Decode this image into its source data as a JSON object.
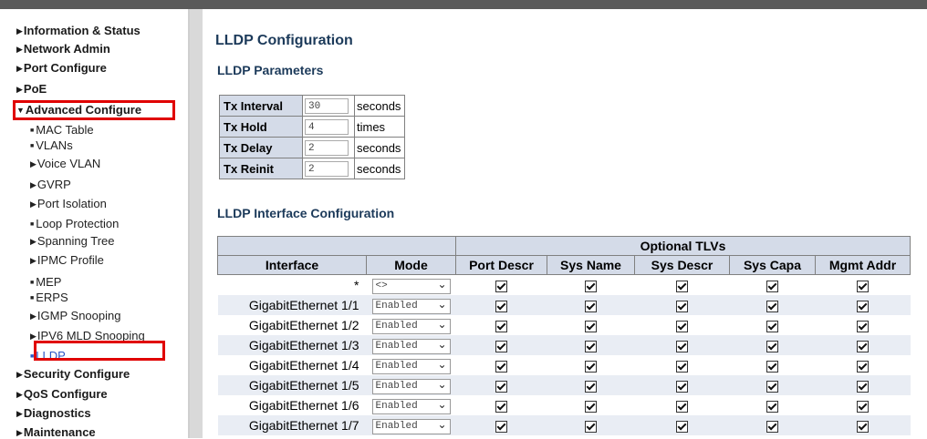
{
  "sidebar": {
    "items": [
      {
        "label": "Information & Status"
      },
      {
        "label": "Network Admin"
      },
      {
        "label": "Port Configure"
      },
      {
        "label": "PoE"
      },
      {
        "label": "Advanced Configure"
      },
      {
        "label": "Security Configure"
      },
      {
        "label": "QoS Configure"
      },
      {
        "label": "Diagnostics"
      },
      {
        "label": "Maintenance"
      }
    ],
    "sub_items": [
      {
        "label": "MAC Table"
      },
      {
        "label": "VLANs"
      },
      {
        "label": "Voice VLAN"
      },
      {
        "label": "GVRP"
      },
      {
        "label": "Port Isolation"
      },
      {
        "label": "Loop Protection"
      },
      {
        "label": "Spanning Tree"
      },
      {
        "label": "IPMC Profile"
      },
      {
        "label": "MEP"
      },
      {
        "label": "ERPS"
      },
      {
        "label": "IGMP Snooping"
      },
      {
        "label": "IPV6 MLD Snooping"
      },
      {
        "label": "LLDP"
      }
    ]
  },
  "page": {
    "title": "LLDP Configuration",
    "params_heading": "LLDP Parameters",
    "intf_heading": "LLDP Interface Configuration"
  },
  "params": [
    {
      "label": "Tx Interval",
      "value": "30",
      "unit": "seconds"
    },
    {
      "label": "Tx Hold",
      "value": "4",
      "unit": "times"
    },
    {
      "label": "Tx Delay",
      "value": "2",
      "unit": "seconds"
    },
    {
      "label": "Tx Reinit",
      "value": "2",
      "unit": "seconds"
    }
  ],
  "intf_table": {
    "group_header": "Optional TLVs",
    "headers": [
      "Interface",
      "Mode",
      "Port Descr",
      "Sys Name",
      "Sys Descr",
      "Sys Capa",
      "Mgmt Addr"
    ],
    "rows": [
      {
        "interface": "*",
        "mode": "<>"
      },
      {
        "interface": "GigabitEthernet 1/1",
        "mode": "Enabled"
      },
      {
        "interface": "GigabitEthernet 1/2",
        "mode": "Enabled"
      },
      {
        "interface": "GigabitEthernet 1/3",
        "mode": "Enabled"
      },
      {
        "interface": "GigabitEthernet 1/4",
        "mode": "Enabled"
      },
      {
        "interface": "GigabitEthernet 1/5",
        "mode": "Enabled"
      },
      {
        "interface": "GigabitEthernet 1/6",
        "mode": "Enabled"
      },
      {
        "interface": "GigabitEthernet 1/7",
        "mode": "Enabled"
      }
    ]
  },
  "colors": {
    "highlight": "#e00000",
    "header_bg": "#d4dbe8",
    "heading": "#1c3a5a"
  }
}
